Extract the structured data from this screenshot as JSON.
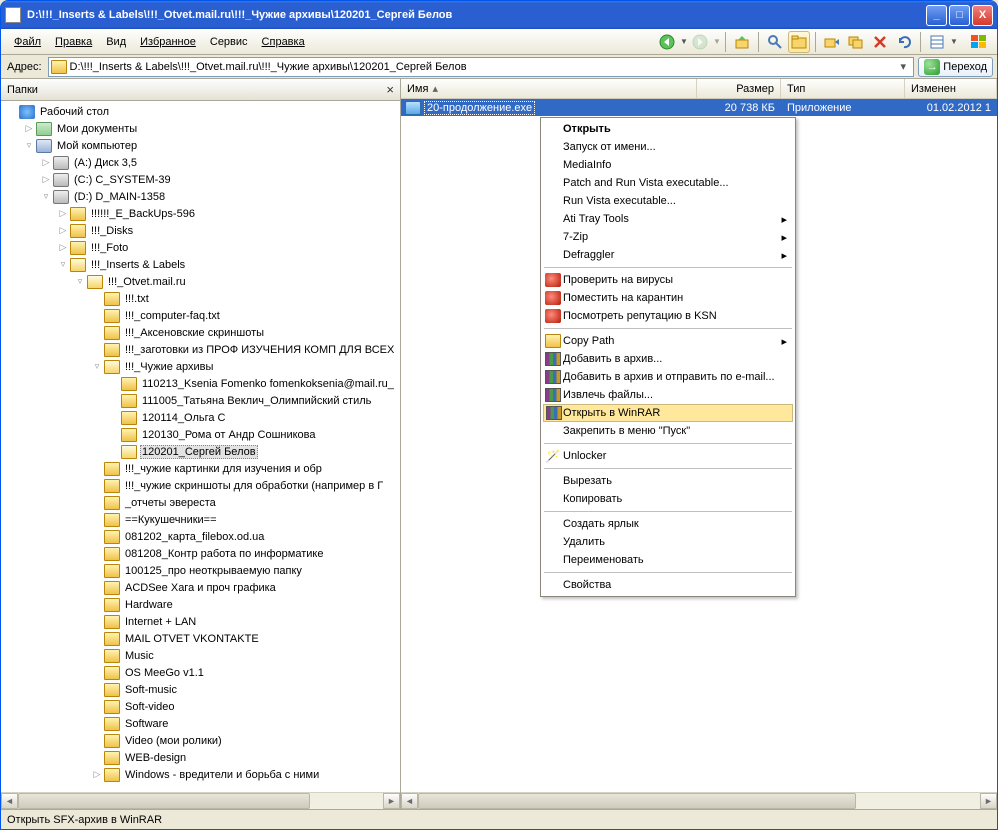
{
  "window": {
    "title": "D:\\!!!_Inserts & Labels\\!!!_Otvet.mail.ru\\!!!_Чужие архивы\\120201_Сергей Белов"
  },
  "winbtns": {
    "min": "_",
    "max": "□",
    "close": "X"
  },
  "menu": {
    "file": "Файл",
    "edit": "Правка",
    "view": "Вид",
    "favorites": "Избранное",
    "tools": "Сервис",
    "help": "Справка"
  },
  "addr": {
    "label": "Адрес:",
    "path": "D:\\!!!_Inserts & Labels\\!!!_Otvet.mail.ru\\!!!_Чужие архивы\\120201_Сергей Белов",
    "go": "Переход"
  },
  "pane": {
    "title": "Папки"
  },
  "tree": [
    {
      "d": 0,
      "expand": "",
      "icon": "desktop-icon",
      "label": "Рабочий стол"
    },
    {
      "d": 1,
      "expand": "▷",
      "icon": "docs-icon",
      "label": "Мои документы"
    },
    {
      "d": 1,
      "expand": "▿",
      "icon": "comp-icon",
      "label": "Мой компьютер"
    },
    {
      "d": 2,
      "expand": "▷",
      "icon": "drive-icon",
      "label": "(A:) Диск 3,5"
    },
    {
      "d": 2,
      "expand": "▷",
      "icon": "drive-icon",
      "label": "(C:) C_SYSTEM-39"
    },
    {
      "d": 2,
      "expand": "▿",
      "icon": "drive-icon",
      "label": "(D:) D_MAIN-1358"
    },
    {
      "d": 3,
      "expand": "▷",
      "icon": "folder-icon",
      "label": "!!!!!!_E_BackUps-596"
    },
    {
      "d": 3,
      "expand": "▷",
      "icon": "folder-icon",
      "label": "!!!_Disks"
    },
    {
      "d": 3,
      "expand": "▷",
      "icon": "folder-icon",
      "label": "!!!_Foto"
    },
    {
      "d": 3,
      "expand": "▿",
      "icon": "folder-open",
      "label": "!!!_Inserts & Labels"
    },
    {
      "d": 4,
      "expand": "▿",
      "icon": "folder-open",
      "label": "!!!_Otvet.mail.ru"
    },
    {
      "d": 5,
      "expand": "",
      "icon": "folder-icon",
      "label": "!!!.txt"
    },
    {
      "d": 5,
      "expand": "",
      "icon": "folder-icon",
      "label": "!!!_computer-faq.txt"
    },
    {
      "d": 5,
      "expand": "",
      "icon": "folder-icon",
      "label": "!!!_Аксеновские скриншоты"
    },
    {
      "d": 5,
      "expand": "",
      "icon": "folder-icon",
      "label": "!!!_заготовки из ПРОФ ИЗУЧЕНИЯ КОМП ДЛЯ ВСЕХ"
    },
    {
      "d": 5,
      "expand": "▿",
      "icon": "folder-open",
      "label": "!!!_Чужие архивы"
    },
    {
      "d": 6,
      "expand": "",
      "icon": "folder-icon",
      "label": "110213_Ksenia Fomenko fomenkoksenia@mail.ru_"
    },
    {
      "d": 6,
      "expand": "",
      "icon": "folder-icon",
      "label": "111005_Татьяна Веклич_Олимпийский стиль"
    },
    {
      "d": 6,
      "expand": "",
      "icon": "folder-icon",
      "label": "120114_Ольга С"
    },
    {
      "d": 6,
      "expand": "",
      "icon": "folder-icon",
      "label": "120130_Рома от Андр Сошникова"
    },
    {
      "d": 6,
      "expand": "",
      "icon": "folder-open",
      "label": "120201_Сергей Белов",
      "selected": true
    },
    {
      "d": 5,
      "expand": "",
      "icon": "folder-icon",
      "label": "!!!_чужие картинки для изучения и обр"
    },
    {
      "d": 5,
      "expand": "",
      "icon": "folder-icon",
      "label": "!!!_чужие скриншоты для обработки (например в Г"
    },
    {
      "d": 5,
      "expand": "",
      "icon": "folder-icon",
      "label": "_отчеты эвереста"
    },
    {
      "d": 5,
      "expand": "",
      "icon": "folder-icon",
      "label": "==Кукушечники=="
    },
    {
      "d": 5,
      "expand": "",
      "icon": "folder-icon",
      "label": "081202_карта_filebox.od.ua"
    },
    {
      "d": 5,
      "expand": "",
      "icon": "folder-icon",
      "label": "081208_Контр работа по информатике"
    },
    {
      "d": 5,
      "expand": "",
      "icon": "folder-icon",
      "label": "100125_про неоткрываемую папку"
    },
    {
      "d": 5,
      "expand": "",
      "icon": "folder-icon",
      "label": "ACDSee Хага и проч графика"
    },
    {
      "d": 5,
      "expand": "",
      "icon": "folder-icon",
      "label": "Hardware"
    },
    {
      "d": 5,
      "expand": "",
      "icon": "folder-icon",
      "label": "Internet + LAN"
    },
    {
      "d": 5,
      "expand": "",
      "icon": "folder-icon",
      "label": "MAIL OTVET VKONTAKTE"
    },
    {
      "d": 5,
      "expand": "",
      "icon": "folder-icon",
      "label": "Music"
    },
    {
      "d": 5,
      "expand": "",
      "icon": "folder-icon",
      "label": "OS MeeGo v1.1"
    },
    {
      "d": 5,
      "expand": "",
      "icon": "folder-icon",
      "label": "Soft-music"
    },
    {
      "d": 5,
      "expand": "",
      "icon": "folder-icon",
      "label": "Soft-video"
    },
    {
      "d": 5,
      "expand": "",
      "icon": "folder-icon",
      "label": "Software"
    },
    {
      "d": 5,
      "expand": "",
      "icon": "folder-icon",
      "label": "Video (мои ролики)"
    },
    {
      "d": 5,
      "expand": "",
      "icon": "folder-icon",
      "label": "WEB-design"
    },
    {
      "d": 5,
      "expand": "▷",
      "icon": "folder-icon",
      "label": "Windows - вредители и борьба с ними"
    }
  ],
  "cols": {
    "name": "Имя",
    "size": "Размер",
    "type": "Тип",
    "mod": "Изменен"
  },
  "files": [
    {
      "name": "20-продолжение.exe",
      "size": "20 738 КБ",
      "type": "Приложение",
      "mod": "01.02.2012 1",
      "selected": true
    }
  ],
  "ctx": [
    {
      "label": "Открыть",
      "bold": true
    },
    {
      "label": "Запуск от имени..."
    },
    {
      "label": "MediaInfo"
    },
    {
      "label": "Patch and Run Vista executable..."
    },
    {
      "label": "Run Vista executable..."
    },
    {
      "label": "Ati Tray Tools",
      "sub": true
    },
    {
      "label": "7-Zip",
      "sub": true
    },
    {
      "label": "Defraggler",
      "sub": true
    },
    {
      "sep": true
    },
    {
      "label": "Проверить на вирусы",
      "icon": "k-icon"
    },
    {
      "label": "Поместить на карантин",
      "icon": "k-icon"
    },
    {
      "label": "Посмотреть репутацию в KSN",
      "icon": "k-icon"
    },
    {
      "sep": true
    },
    {
      "label": "Copy Path",
      "icon": "ext-icon",
      "sub": true
    },
    {
      "label": "Добавить в архив...",
      "icon": "rar-icon"
    },
    {
      "label": "Добавить в архив и отправить по e-mail...",
      "icon": "rar-icon"
    },
    {
      "label": "Извлечь файлы...",
      "icon": "rar-icon"
    },
    {
      "label": "Открыть в WinRAR",
      "icon": "rar-icon",
      "hi": true
    },
    {
      "label": "Закрепить в меню \"Пуск\""
    },
    {
      "sep": true
    },
    {
      "label": "Unlocker",
      "icon": "unlock-icon",
      "iconText": "🪄"
    },
    {
      "sep": true
    },
    {
      "label": "Вырезать"
    },
    {
      "label": "Копировать"
    },
    {
      "sep": true
    },
    {
      "label": "Создать ярлык"
    },
    {
      "label": "Удалить"
    },
    {
      "label": "Переименовать"
    },
    {
      "sep": true
    },
    {
      "label": "Свойства"
    }
  ],
  "status": "Открыть SFX-архив в WinRAR"
}
